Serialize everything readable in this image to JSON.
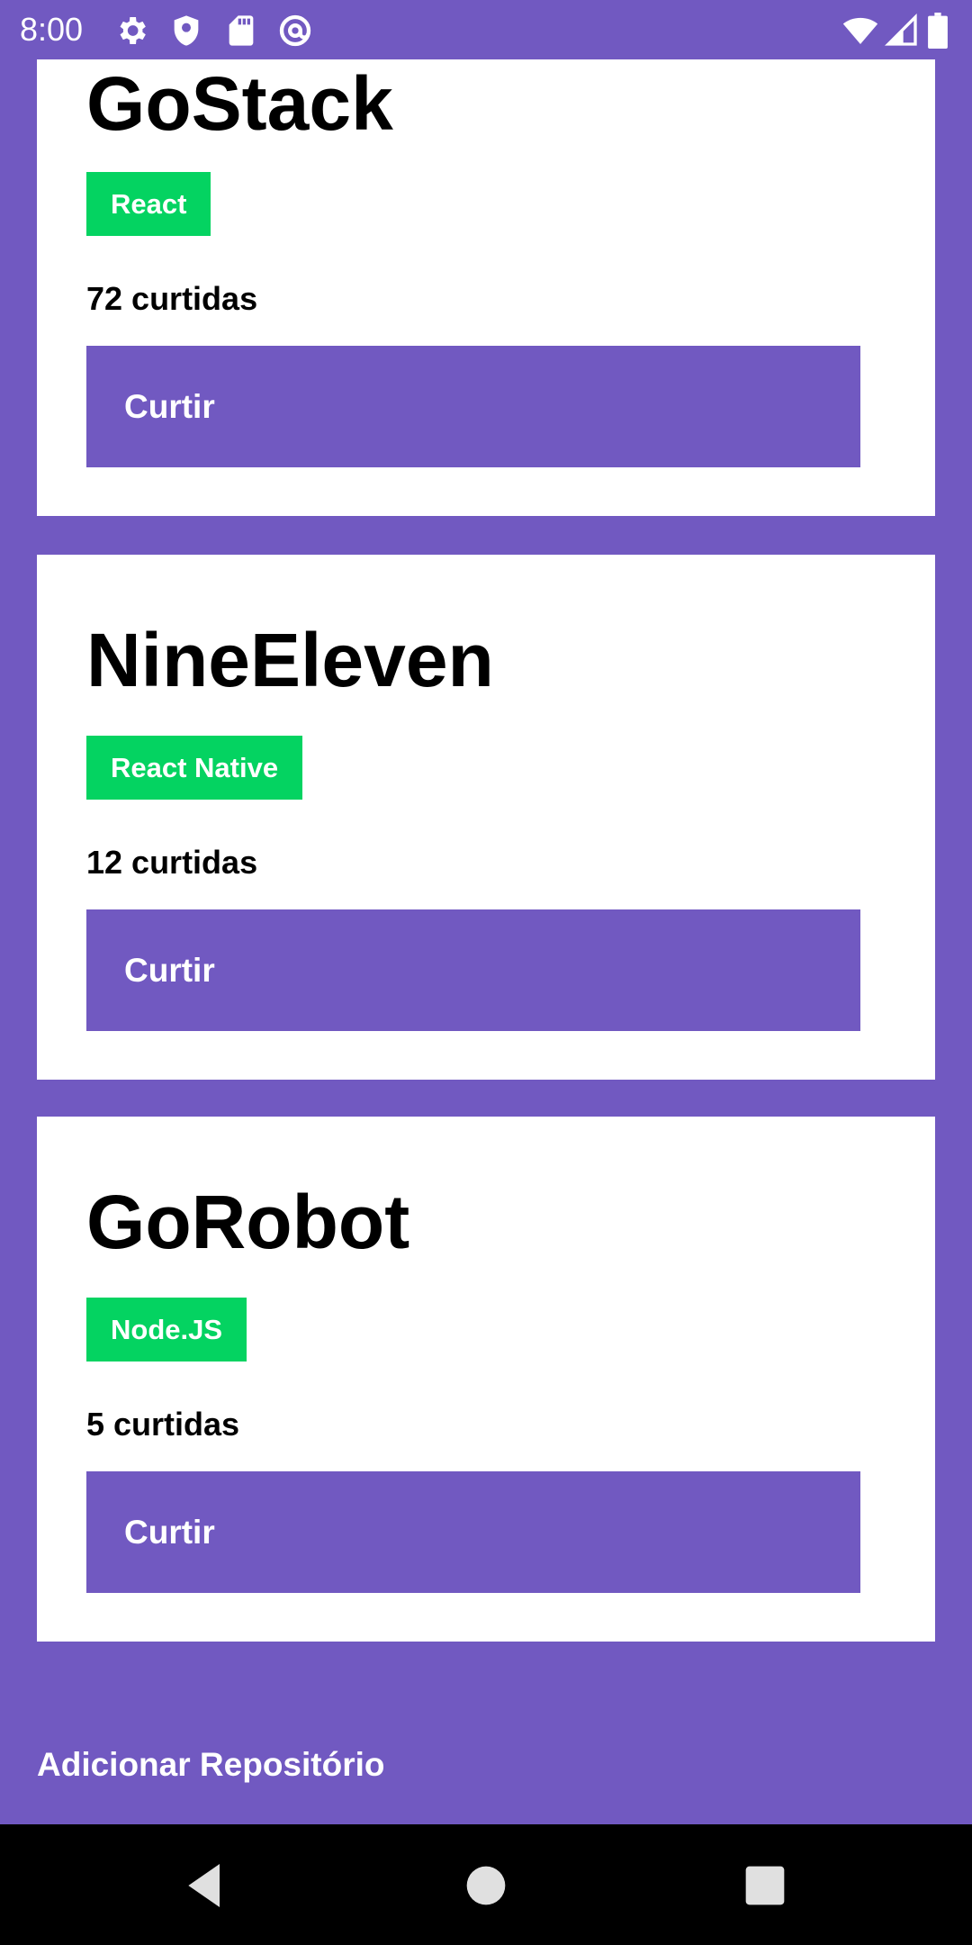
{
  "status_bar": {
    "time": "8:00",
    "icons": [
      "settings-icon",
      "shield-icon",
      "sd-card-icon",
      "at-sign-icon",
      "wifi-icon",
      "cellular-signal-icon",
      "battery-icon"
    ]
  },
  "colors": {
    "background": "#7159c1",
    "card": "#ffffff",
    "badge": "#04d361",
    "button": "#7159c1",
    "nav_bar": "#000000"
  },
  "repositories": [
    {
      "title": "GoStack",
      "tech": "React",
      "likes": "72 curtidas",
      "like_label": "Curtir"
    },
    {
      "title": "NineEleven",
      "tech": "React Native",
      "likes": "12 curtidas",
      "like_label": "Curtir"
    },
    {
      "title": "GoRobot",
      "tech": "Node.JS",
      "likes": "5 curtidas",
      "like_label": "Curtir"
    }
  ],
  "add_repository_label": "Adicionar Repositório",
  "navigation": {
    "icons": [
      "back-icon",
      "home-icon",
      "recents-icon"
    ]
  }
}
